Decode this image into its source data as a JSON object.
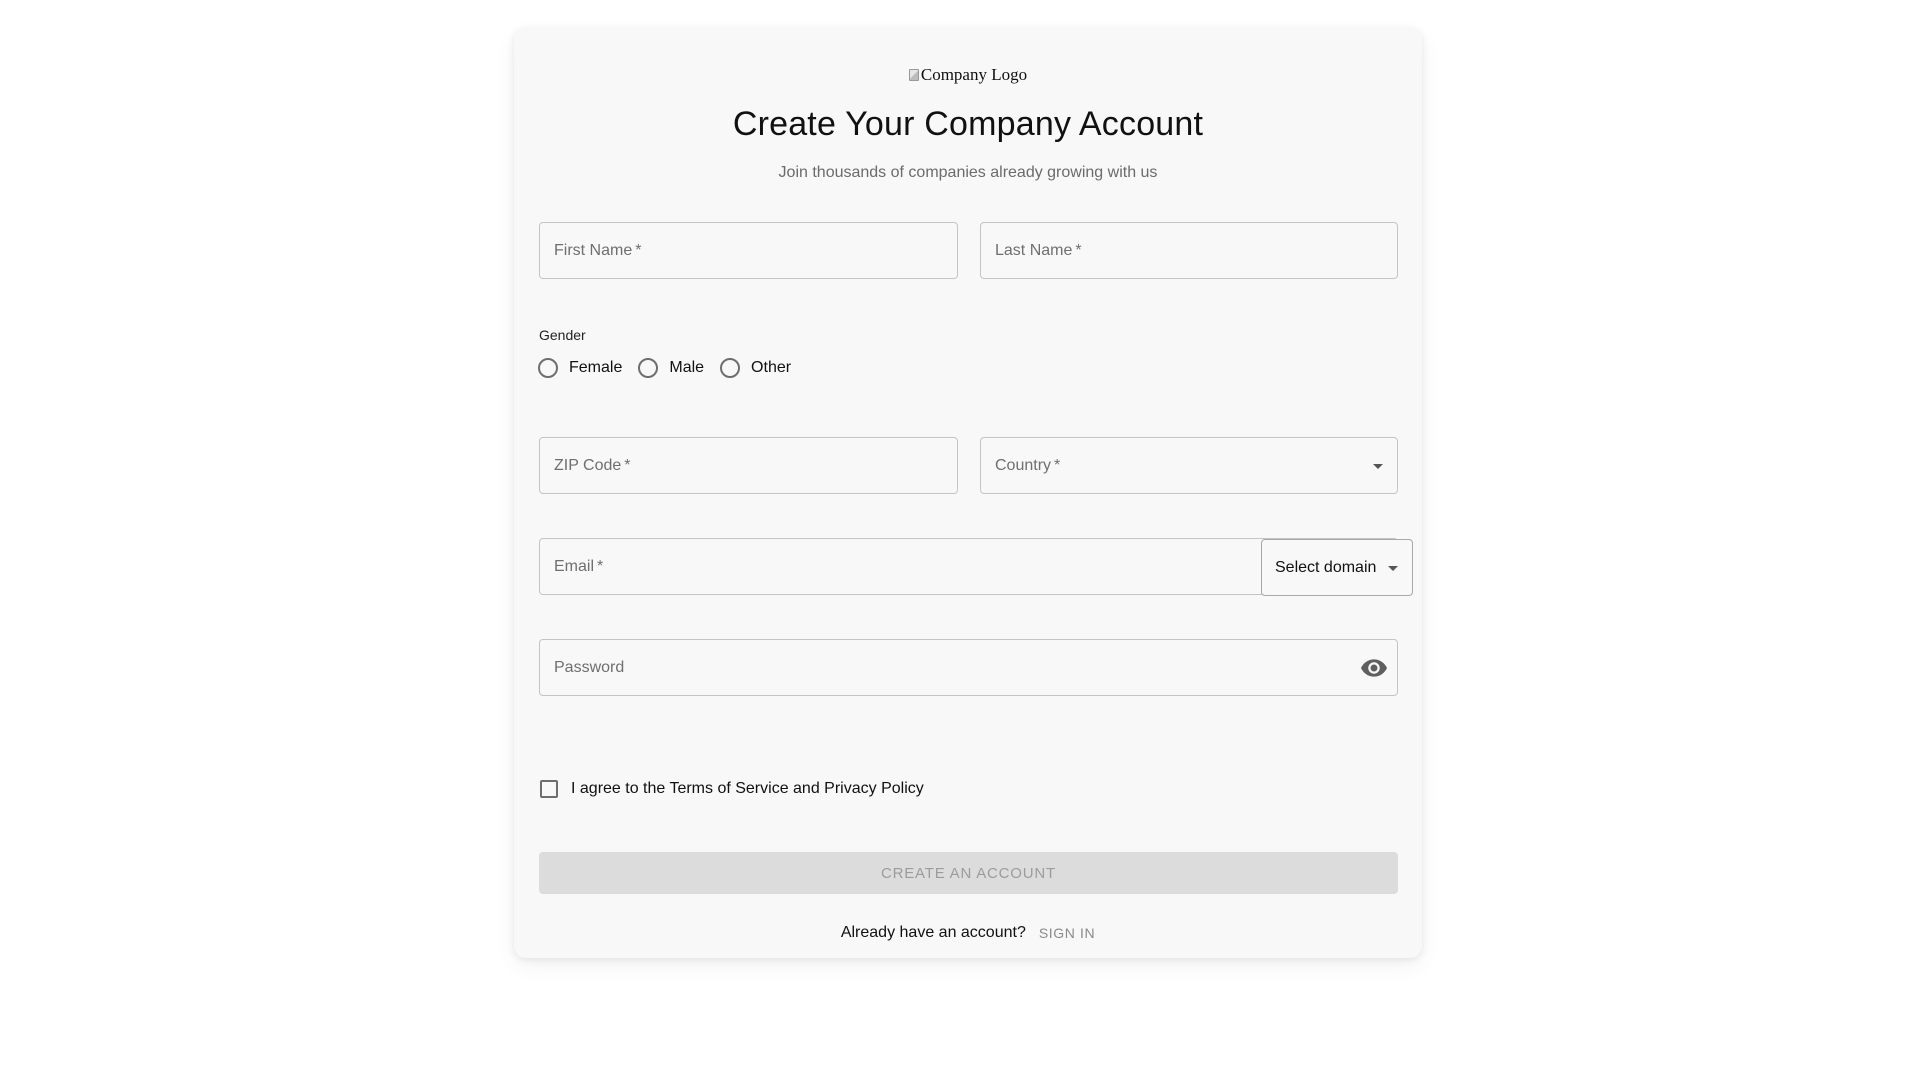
{
  "header": {
    "logo_alt": "Company Logo",
    "title": "Create Your Company Account",
    "subtitle": "Join thousands of companies already growing with us"
  },
  "form": {
    "first_name": {
      "label": "First Name",
      "required_mark": "*"
    },
    "last_name": {
      "label": "Last Name",
      "required_mark": "*"
    },
    "gender": {
      "label": "Gender",
      "options": [
        "Female",
        "Male",
        "Other"
      ],
      "selected": null
    },
    "zip": {
      "label": "ZIP Code",
      "required_mark": "*"
    },
    "country": {
      "label": "Country",
      "required_mark": "*",
      "icon": "chevron-down-icon"
    },
    "email": {
      "label": "Email",
      "required_mark": "*"
    },
    "domain": {
      "label": "Select domain",
      "icon": "chevron-down-icon"
    },
    "password": {
      "label": "Password",
      "icon": "eye-icon"
    },
    "agree": {
      "label": "I agree to the Terms of Service and Privacy Policy",
      "checked": false
    },
    "submit": {
      "label": "CREATE AN ACCOUNT",
      "disabled": true
    }
  },
  "footer": {
    "prompt": "Already have an account?",
    "signin_label": "SIGN IN"
  },
  "colors": {
    "card_bg": "#f8f8f8",
    "button_disabled_bg": "#dcdcdd",
    "button_disabled_text": "#9c9c9c",
    "field_border": "#c4c4c4"
  }
}
